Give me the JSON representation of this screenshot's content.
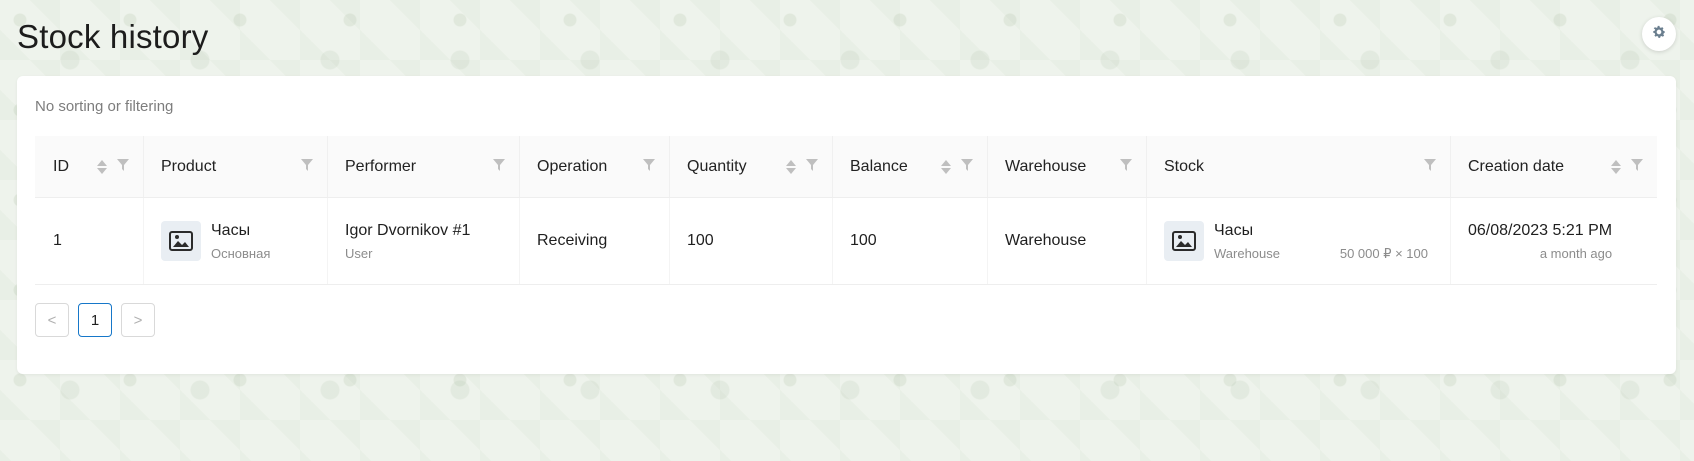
{
  "page": {
    "title": "Stock history"
  },
  "status_text": "No sorting or filtering",
  "columns": [
    "ID",
    "Product",
    "Performer",
    "Operation",
    "Quantity",
    "Balance",
    "Warehouse",
    "Stock",
    "Creation date"
  ],
  "rows": [
    {
      "id": "1",
      "product_name": "Часы",
      "product_variant": "Основная",
      "performer_name": "Igor Dvornikov #1",
      "performer_role": "User",
      "operation": "Receiving",
      "quantity": "100",
      "balance": "100",
      "warehouse": "Warehouse",
      "stock_name": "Часы",
      "stock_warehouse": "Warehouse",
      "stock_price": "50 000 ₽ × 100",
      "date": "06/08/2023 5:21 PM",
      "date_relative": "a month ago"
    }
  ],
  "pagination": {
    "prev": "<",
    "current": "1",
    "next": ">"
  },
  "icons": {
    "settings": "gear-icon",
    "sort": "sort-icon",
    "filter": "filter-icon",
    "image": "image-icon"
  },
  "colors": {
    "accent": "#1677c9",
    "muted": "#8c8c8c",
    "background": "#eef3ec"
  }
}
